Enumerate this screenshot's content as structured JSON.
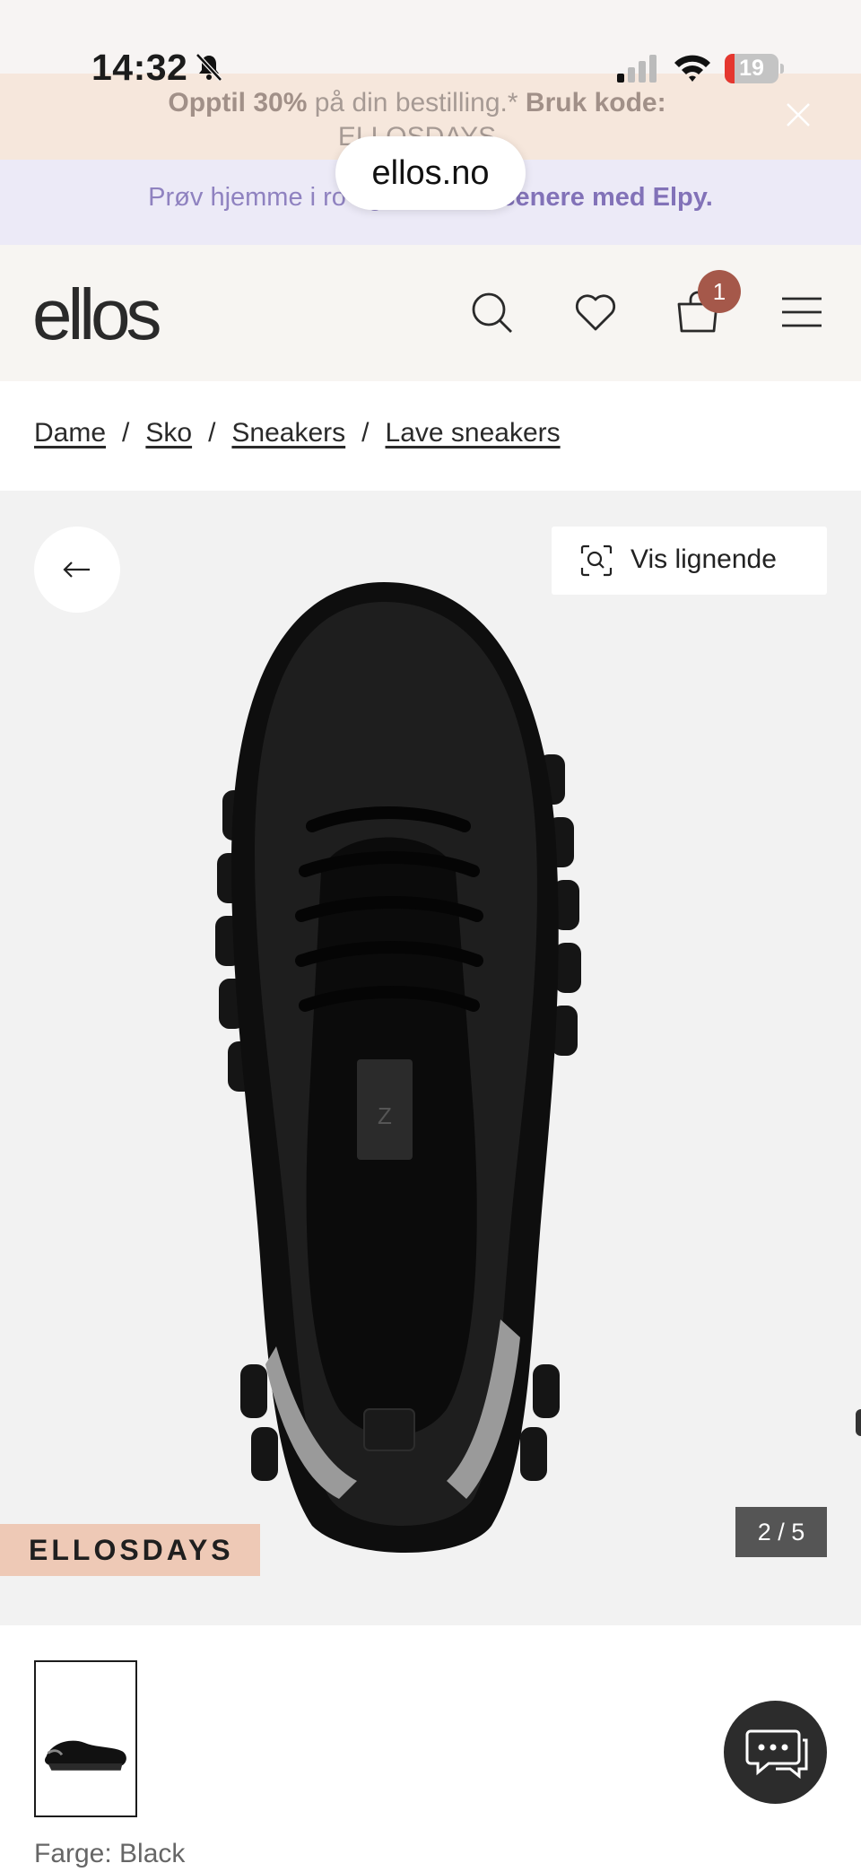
{
  "status_bar": {
    "time": "14:32",
    "battery": "19",
    "battery_level": 0.19
  },
  "promo": {
    "bold1": "Opptil 30%",
    "text1": " på din bestilling.* ",
    "bold2": "Bruk kode:",
    "code": "ELLOSDAYS"
  },
  "elpy": {
    "text": "Prøv hjemme i ro og ",
    "bold": "ro. Betal senere med Elpy."
  },
  "browser": {
    "url": "ellos.no"
  },
  "header": {
    "logo": "ellos",
    "cart_count": "1"
  },
  "breadcrumb": [
    "Dame",
    "Sko",
    "Sneakers",
    "Lave sneakers"
  ],
  "breadcrumb_sep": "/",
  "gallery": {
    "similar_label": "Vis lignende",
    "promo_tag": "ELLOSDAYS",
    "counter": "2 / 5",
    "current": 2,
    "total": 5
  },
  "product": {
    "color_label": "Farge: Black"
  },
  "colors": {
    "accent_badge": "#a5584a",
    "promo_tag_bg": "#eec9b6",
    "elpy_text": "#8272b8"
  },
  "icons": [
    "bell-muted-icon",
    "signal-icon",
    "wifi-icon",
    "close-icon",
    "search-icon",
    "heart-icon",
    "cart-icon",
    "menu-icon",
    "arrow-left-icon",
    "visual-search-icon",
    "chat-icon"
  ]
}
